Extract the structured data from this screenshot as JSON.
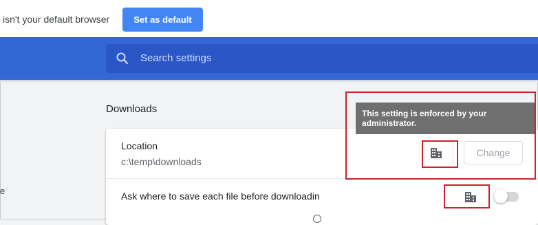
{
  "infobar": {
    "message": "isn't your default browser",
    "button_label": "Set as default"
  },
  "header": {
    "search_placeholder": "Search settings",
    "color": "#3367d6"
  },
  "sidebar": {
    "partial_item": "e"
  },
  "downloads": {
    "section_title": "Downloads",
    "location_label": "Location",
    "location_value": "c:\\temp\\downloads",
    "change_button_label": "Change",
    "ask_label": "Ask where to save each file before downloadin",
    "ask_toggle_on": false
  },
  "tooltip": {
    "text": "This setting is enforced by your administrator."
  },
  "icons": {
    "search": "search-icon",
    "policy": "enterprise-building-icon"
  },
  "annotation_color": "#d0202a"
}
